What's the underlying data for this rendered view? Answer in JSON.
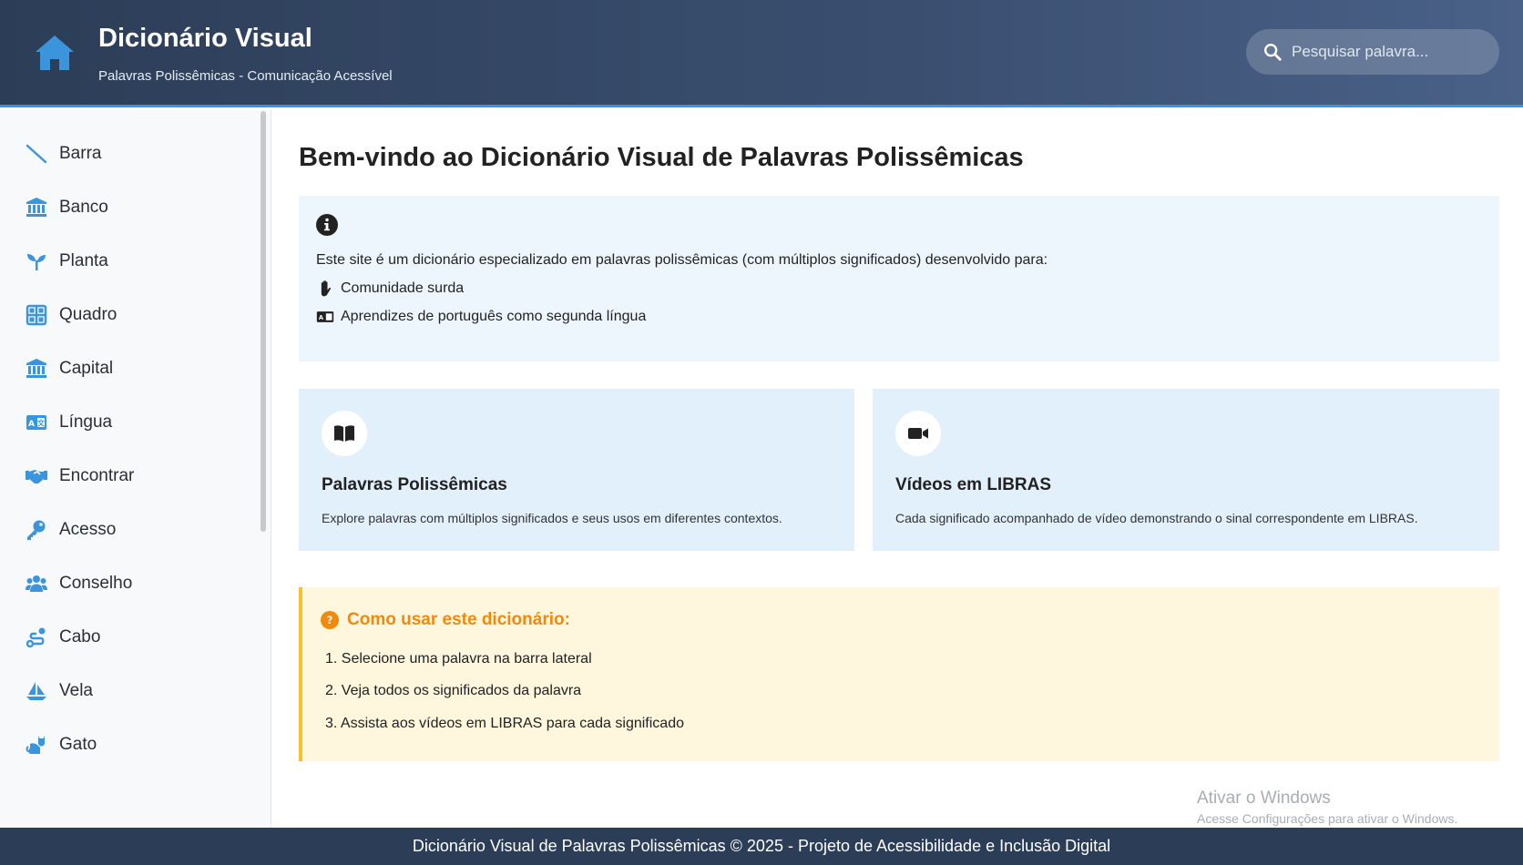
{
  "header": {
    "title": "Dicionário Visual",
    "subtitle": "Palavras Polissêmicas - Comunicação Acessível",
    "home_icon": "home-icon",
    "search_placeholder": "Pesquisar palavra..."
  },
  "sidebar": {
    "items": [
      {
        "label": "Barra",
        "icon": "slash-icon"
      },
      {
        "label": "Banco",
        "icon": "bank-icon"
      },
      {
        "label": "Planta",
        "icon": "seedling-icon"
      },
      {
        "label": "Quadro",
        "icon": "grid-icon"
      },
      {
        "label": "Capital",
        "icon": "bank-icon"
      },
      {
        "label": "Língua",
        "icon": "language-icon"
      },
      {
        "label": "Encontrar",
        "icon": "handshake-icon"
      },
      {
        "label": "Acesso",
        "icon": "key-icon"
      },
      {
        "label": "Conselho",
        "icon": "users-icon"
      },
      {
        "label": "Cabo",
        "icon": "route-icon"
      },
      {
        "label": "Vela",
        "icon": "sailboat-icon"
      },
      {
        "label": "Gato",
        "icon": "cat-icon"
      }
    ]
  },
  "main": {
    "title": "Bem-vindo ao Dicionário Visual de Palavras Polissêmicas",
    "info": {
      "text": "Este site é um dicionário especializado em palavras polissêmicas (com múltiplos significados) desenvolvido para:",
      "items": [
        "Comunidade surda",
        "Aprendizes de português como segunda língua"
      ]
    },
    "cards": [
      {
        "title": "Palavras Polissêmicas",
        "text": "Explore palavras com múltiplos significados e seus usos em diferentes contextos.",
        "icon": "book-icon"
      },
      {
        "title": "Vídeos em LIBRAS",
        "text": "Cada significado acompanhado de vídeo demonstrando o sinal correspondente em LIBRAS.",
        "icon": "video-icon"
      }
    ],
    "howto": {
      "title": "Como usar este dicionário:",
      "steps": [
        "1. Selecione uma palavra na barra lateral",
        "2. Veja todos os significados da palavra",
        "3. Assista aos vídeos em LIBRAS para cada significado"
      ]
    }
  },
  "watermark": {
    "line1": "Ativar o Windows",
    "line2": "Acesse Configurações para ativar o Windows."
  },
  "footer": {
    "text": "Dicionário Visual de Palavras Polissêmicas © 2025 - Projeto de Acessibilidade e Inclusão Digital"
  },
  "colors": {
    "header_bg": "#2c3d57",
    "accent": "#3b95dc",
    "info_bg": "#eef6fd",
    "card_bg": "#e2f0fb",
    "howto_bg": "#fef6dd",
    "howto_title": "#f08a0c"
  }
}
